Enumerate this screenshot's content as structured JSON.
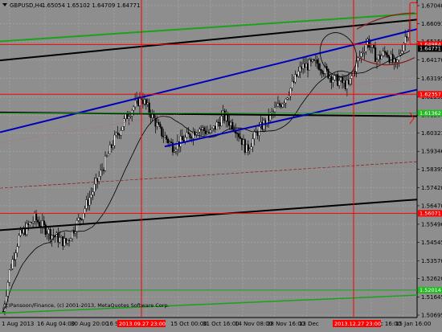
{
  "header": {
    "symbol": "GBPUSD,H4",
    "quotes": "1.65054 1.65102 1.64709 1.64771"
  },
  "copyright": "(c)Pansoon/Finance, (c) 2001-2013, MetaQuotes Software Corp.",
  "colors": {
    "background": "#8e8e8e",
    "grid": "#a9a9a9",
    "red": "#ff0000",
    "green": "#22bb22",
    "blue": "#0000bb",
    "black": "#000000",
    "darkred": "#8b1a1a"
  },
  "chart_data": {
    "type": "candlestick",
    "y_ticks": [
      "1.67040",
      "1.66091",
      "1.65150",
      "1.64170",
      "1.63195",
      "1.62232",
      "1.61260",
      "1.60321",
      "1.59346",
      "1.58395",
      "1.57420",
      "1.56470",
      "1.55496",
      "1.54545",
      "1.53570",
      "1.52620",
      "1.51645",
      "1.50695"
    ],
    "y_range": [
      1.50695,
      1.6704
    ],
    "price_tags": [
      {
        "label": "1.64984",
        "value": 1.64984,
        "color": "#ff0000"
      },
      {
        "label": "1.62357",
        "value": 1.62357,
        "color": "#ff0000"
      },
      {
        "label": "1.61362",
        "value": 1.61362,
        "color": "#22bb22"
      },
      {
        "label": "1.56071",
        "value": 1.56071,
        "color": "#ff0000"
      },
      {
        "label": "1.52014",
        "value": 1.52014,
        "color": "#22bb22"
      },
      {
        "label": "1.64771",
        "value": 1.64771,
        "color": "#000000"
      }
    ],
    "x_ticks": [
      "1 Aug 2013",
      "16 Aug 04:00",
      "30 Aug 20:00",
      "16 Sep 08:00",
      "",
      "15 Oct 00:00",
      "31 Oct 16:00",
      "14 Nov 08:00",
      "28 Nov 16:00",
      "13 Dec",
      "",
      "31 Dec 16:00",
      "15 Jan 16:00"
    ],
    "date_tags": [
      "2013.09.27 23:00",
      "2013.12.27 23:00"
    ]
  }
}
